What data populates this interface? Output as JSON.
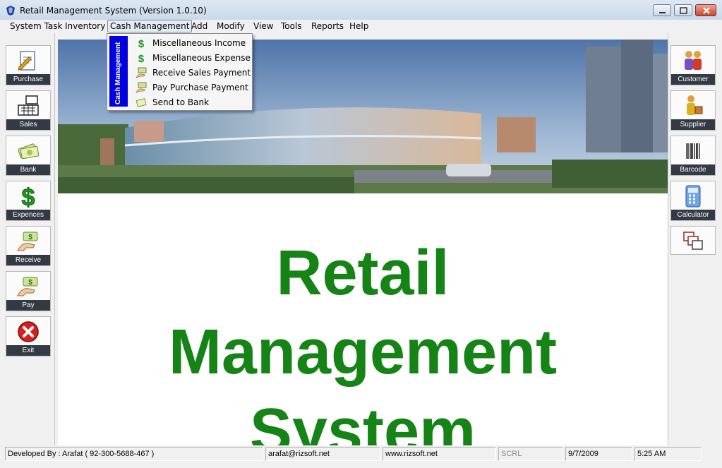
{
  "window": {
    "title": "Retail Management System (Version 1.0.10)"
  },
  "menubar": {
    "items": [
      "System Task",
      "Inventory",
      "Cash Management",
      "Add",
      "Modify",
      "View",
      "Tools",
      "Reports",
      "Help"
    ]
  },
  "dropdown": {
    "header": "Cash Management",
    "items": [
      {
        "label": "Miscellaneous Income",
        "icon": "dollar-icon"
      },
      {
        "label": "Miscellaneous Expense",
        "icon": "dollar-icon"
      },
      {
        "label": "Receive Sales Payment",
        "icon": "cash-receive-icon"
      },
      {
        "label": "Pay Purchase Payment",
        "icon": "cash-pay-icon"
      },
      {
        "label": "Send to Bank",
        "icon": "bank-send-icon"
      }
    ]
  },
  "left_toolbar": {
    "buttons": [
      {
        "label": "Purchase",
        "icon": "document-pencil-icon"
      },
      {
        "label": "Sales",
        "icon": "cash-register-icon"
      },
      {
        "label": "Bank",
        "icon": "money-stack-icon"
      },
      {
        "label": "Expences",
        "icon": "dollar-sign-icon"
      },
      {
        "label": "Receive",
        "icon": "hand-money-icon"
      },
      {
        "label": "Pay",
        "icon": "hand-pay-icon"
      },
      {
        "label": "Exit",
        "icon": "red-x-icon"
      }
    ]
  },
  "right_toolbar": {
    "buttons": [
      {
        "label": "Customer",
        "icon": "people-icon"
      },
      {
        "label": "Supplier",
        "icon": "person-box-icon"
      },
      {
        "label": "Barcode",
        "icon": "barcode-icon"
      },
      {
        "label": "Calculator",
        "icon": "calculator-icon"
      },
      {
        "label": "",
        "icon": "windows-cascade-icon"
      }
    ]
  },
  "main": {
    "title_lines": [
      "Retail",
      "Management",
      "System"
    ]
  },
  "statusbar": {
    "developer": "Developed By : Arafat ( 92-300-5688-467 )",
    "email": "arafat@rizsoft.net",
    "website": "www.rizsoft.net",
    "scroll": "SCRL",
    "date": "9/7/2009",
    "time": "5:25 AM"
  },
  "colors": {
    "title_green": "#158315",
    "dropdown_strip": "#0000e0",
    "button_label_bg": "#333a44"
  }
}
